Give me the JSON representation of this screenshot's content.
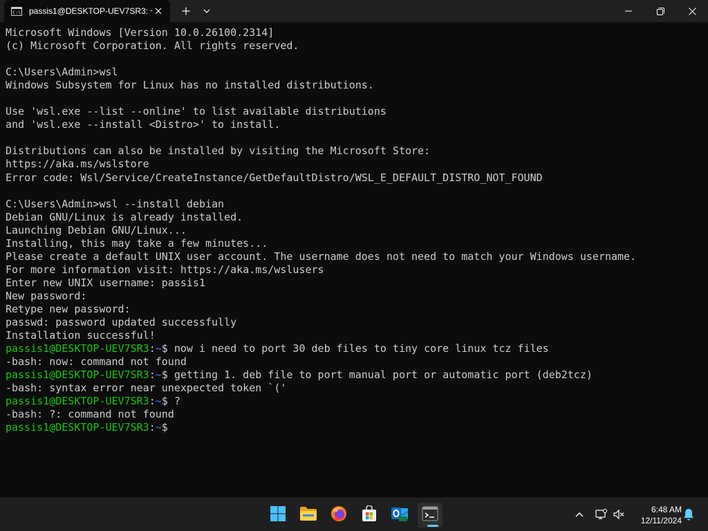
{
  "window": {
    "tab_title": "passis1@DESKTOP-UEV7SR3: ~",
    "icons": {
      "tab": "terminal-tab-icon",
      "close_tab": "close-icon",
      "new_tab": "plus-icon",
      "dropdown": "chevron-down-icon",
      "minimize": "minimize-icon",
      "maximize": "maximize-icon",
      "close_window": "close-icon"
    }
  },
  "terminal": {
    "colors": {
      "text": "#cccccc",
      "user": "#16c60c",
      "path": "#3b78ff",
      "background": "#0c0c0c"
    },
    "lines": [
      {
        "text": "Microsoft Windows [Version 10.0.26100.2314]"
      },
      {
        "text": "(c) Microsoft Corporation. All rights reserved."
      },
      {
        "text": ""
      },
      {
        "text": "C:\\Users\\Admin>wsl"
      },
      {
        "text": "Windows Subsystem for Linux has no installed distributions."
      },
      {
        "text": ""
      },
      {
        "text": "Use 'wsl.exe --list --online' to list available distributions"
      },
      {
        "text": "and 'wsl.exe --install <Distro>' to install."
      },
      {
        "text": ""
      },
      {
        "text": "Distributions can also be installed by visiting the Microsoft Store:"
      },
      {
        "text": "https://aka.ms/wslstore"
      },
      {
        "text": "Error code: Wsl/Service/CreateInstance/GetDefaultDistro/WSL_E_DEFAULT_DISTRO_NOT_FOUND"
      },
      {
        "text": ""
      },
      {
        "text": "C:\\Users\\Admin>wsl --install debian"
      },
      {
        "text": "Debian GNU/Linux is already installed."
      },
      {
        "text": "Launching Debian GNU/Linux..."
      },
      {
        "text": "Installing, this may take a few minutes..."
      },
      {
        "text": "Please create a default UNIX user account. The username does not need to match your Windows username."
      },
      {
        "text": "For more information visit: https://aka.ms/wslusers"
      },
      {
        "text": "Enter new UNIX username: passis1"
      },
      {
        "text": "New password:"
      },
      {
        "text": "Retype new password:"
      },
      {
        "text": "passwd: password updated successfully"
      },
      {
        "text": "Installation successful!"
      },
      {
        "prompt": {
          "user": "passis1@DESKTOP-UEV7SR3",
          "sep": ":",
          "path": "~",
          "dollar": "$"
        },
        "text": " now i need to port 30 deb files to tiny core linux tcz files"
      },
      {
        "text": "-bash: now: command not found"
      },
      {
        "prompt": {
          "user": "passis1@DESKTOP-UEV7SR3",
          "sep": ":",
          "path": "~",
          "dollar": "$"
        },
        "text": " getting 1. deb file to port manual port or automatic port (deb2tcz)"
      },
      {
        "text": "-bash: syntax error near unexpected token `('"
      },
      {
        "prompt": {
          "user": "passis1@DESKTOP-UEV7SR3",
          "sep": ":",
          "path": "~",
          "dollar": "$"
        },
        "text": " ?"
      },
      {
        "text": "-bash: ?: command not found"
      },
      {
        "prompt": {
          "user": "passis1@DESKTOP-UEV7SR3",
          "sep": ":",
          "path": "~",
          "dollar": "$"
        },
        "text": ""
      }
    ]
  },
  "taskbar": {
    "apps": [
      {
        "name": "start-button",
        "icon": "windows-logo-icon"
      },
      {
        "name": "file-explorer-button",
        "icon": "folder-icon"
      },
      {
        "name": "firefox-button",
        "icon": "firefox-icon"
      },
      {
        "name": "microsoft-store-button",
        "icon": "store-icon"
      },
      {
        "name": "outlook-button",
        "icon": "outlook-icon"
      },
      {
        "name": "terminal-button",
        "icon": "terminal-icon",
        "active": true
      }
    ],
    "tray": {
      "icons": [
        "chevron-up-icon",
        "network-icon",
        "volume-muted-icon",
        "notification-bell-icon"
      ]
    },
    "clock": {
      "time": "6:48 AM",
      "date": "12/11/2024"
    }
  }
}
